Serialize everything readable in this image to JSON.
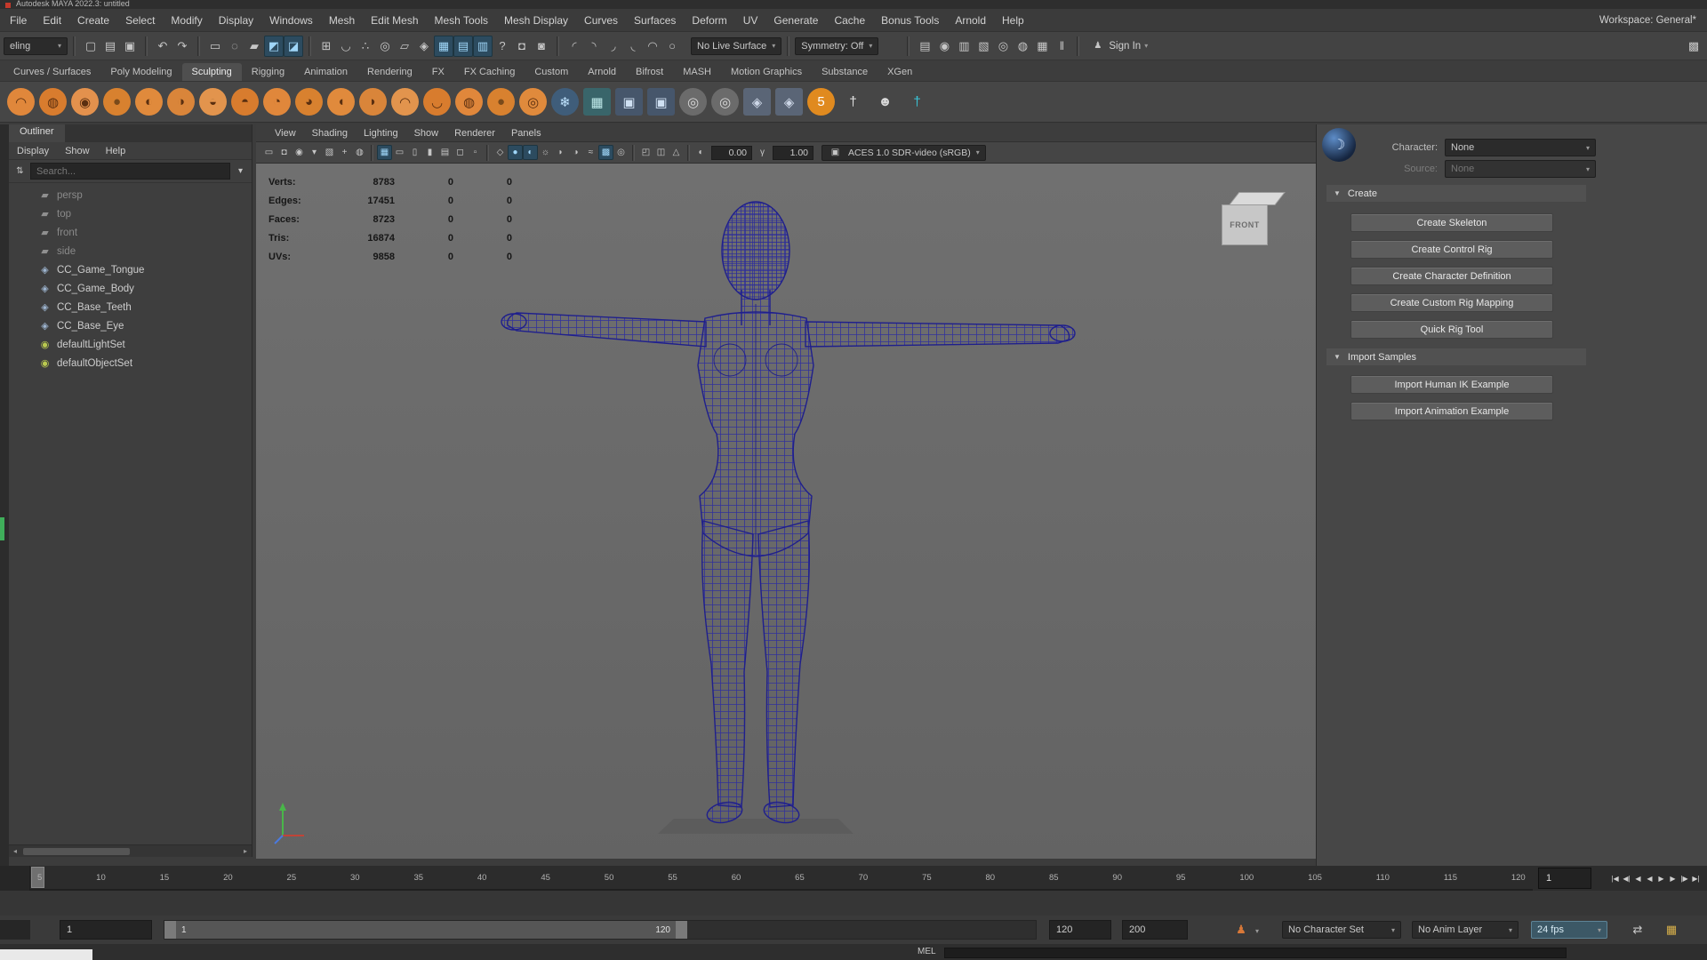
{
  "title_bar": {
    "title": "Autodesk MAYA 2022.3: untitled"
  },
  "menu_bar": {
    "items": [
      "File",
      "Edit",
      "Create",
      "Select",
      "Modify",
      "Display",
      "Windows",
      "Mesh",
      "Edit Mesh",
      "Mesh Tools",
      "Mesh Display",
      "Curves",
      "Surfaces",
      "Deform",
      "UV",
      "Generate",
      "Cache",
      "Bonus Tools",
      "Arnold",
      "Help"
    ],
    "workspace": "Workspace: General*"
  },
  "status_line": {
    "workspace_value": "eling",
    "file_icons": [
      {
        "n": "new-scene-icon",
        "g": "▢"
      },
      {
        "n": "open-scene-icon",
        "g": "▤"
      },
      {
        "n": "save-scene-icon",
        "g": "▣"
      }
    ],
    "undo_icons": [
      {
        "n": "undo-icon",
        "g": "↶"
      },
      {
        "n": "redo-icon",
        "g": "↷"
      }
    ],
    "selection_icons": [
      {
        "n": "select-tool-icon",
        "g": "▭"
      },
      {
        "n": "lasso-select-icon",
        "g": "◌"
      },
      {
        "n": "paint-select-icon",
        "g": "▰"
      },
      {
        "n": "select-object-mode-icon",
        "g": "◩",
        "s": "on"
      },
      {
        "n": "select-component-mode-icon",
        "g": "◪",
        "s": "on"
      }
    ],
    "snap_icons": [
      {
        "n": "snap-to-grid-icon",
        "g": "⊞"
      },
      {
        "n": "snap-to-curve-icon",
        "g": "◡"
      },
      {
        "n": "snap-to-point-icon",
        "g": "∴"
      },
      {
        "n": "snap-to-projected-center-icon",
        "g": "◎"
      },
      {
        "n": "snap-to-view-plane-icon",
        "g": "▱"
      },
      {
        "n": "make-live-icon",
        "g": "◈"
      },
      {
        "n": "modeling-toolkit-icon",
        "g": "▦",
        "s": "on"
      },
      {
        "n": "soft-select-icon",
        "g": "▤",
        "s": "on"
      },
      {
        "n": "symmetry-grid-icon",
        "g": "▥",
        "s": "on"
      },
      {
        "n": "help-icon",
        "g": "?"
      },
      {
        "n": "lock-selection-icon",
        "g": "◘"
      },
      {
        "n": "highlight-selection-icon",
        "g": "◙"
      }
    ],
    "curve_icons": [
      {
        "n": "curve-tool-icon",
        "g": "◜"
      },
      {
        "n": "cv-curve-icon",
        "g": "◝"
      },
      {
        "n": "ep-curve-icon",
        "g": "◞"
      },
      {
        "n": "pencil-curve-icon",
        "g": "◟"
      },
      {
        "n": "arc-tool-icon",
        "g": "◠"
      },
      {
        "n": "circle-tool-icon",
        "g": "○"
      }
    ],
    "live_surface_label": "No Live Surface",
    "symmetry_label": "Symmetry: Off",
    "render_icons": [
      {
        "n": "render-settings-icon",
        "g": "▤"
      },
      {
        "n": "hypershade-icon",
        "g": "◉"
      },
      {
        "n": "render-view-icon",
        "g": "▥"
      },
      {
        "n": "texture-view-icon",
        "g": "▧"
      },
      {
        "n": "render-current-frame-icon",
        "g": "◎"
      },
      {
        "n": "ipr-render-icon",
        "g": "◍"
      },
      {
        "n": "render-sequence-icon",
        "g": "▦"
      },
      {
        "n": "pause-viewport-icon",
        "g": "‖"
      }
    ],
    "sign_in_label": "Sign In",
    "right_icons": [
      {
        "n": "raise-panels-icon",
        "g": "▩"
      }
    ]
  },
  "shelf": {
    "tabs": [
      {
        "l": "Curves / Surfaces"
      },
      {
        "l": "Poly Modeling"
      },
      {
        "l": "Sculpting",
        "s": "on"
      },
      {
        "l": "Rigging"
      },
      {
        "l": "Animation"
      },
      {
        "l": "Rendering"
      },
      {
        "l": "FX"
      },
      {
        "l": "FX Caching"
      },
      {
        "l": "Custom"
      },
      {
        "l": "Arnold"
      },
      {
        "l": "Bifrost"
      },
      {
        "l": "MASH"
      },
      {
        "l": "Motion Graphics"
      },
      {
        "l": "Substance"
      },
      {
        "l": "XGen"
      }
    ],
    "icons": [
      {
        "n": "lift-brush-icon",
        "g": "◠",
        "bg": "#e0873b",
        "fg": "#5a2f10"
      },
      {
        "n": "sculpt-brush-icon",
        "g": "◍",
        "bg": "#d87c2e",
        "fg": "#5a2f10"
      },
      {
        "n": "smooth-brush-icon",
        "g": "◉",
        "bg": "#e3914d",
        "fg": "#5a2f10"
      },
      {
        "n": "relax-brush-icon",
        "g": "●",
        "bg": "#d8812f",
        "fg": "#7a4a1a"
      },
      {
        "n": "grab-brush-icon",
        "g": "◐",
        "bg": "#e08a3c",
        "fg": "#5a2f10"
      },
      {
        "n": "pinch-brush-icon",
        "g": "◑",
        "bg": "#d9853a",
        "fg": "#5a2f10"
      },
      {
        "n": "flatten-brush-icon",
        "g": "◒",
        "bg": "#e2944d",
        "fg": "#5a2f10"
      },
      {
        "n": "foamy-brush-icon",
        "g": "◓",
        "bg": "#d87c2e",
        "fg": "#5a2f10"
      },
      {
        "n": "spray-brush-icon",
        "g": "◔",
        "bg": "#e0873b",
        "fg": "#5a2f10"
      },
      {
        "n": "repeat-brush-icon",
        "g": "◕",
        "bg": "#d8812f",
        "fg": "#5a2f10"
      },
      {
        "n": "imprint-brush-icon",
        "g": "◖",
        "bg": "#e08a3c",
        "fg": "#5a2f10"
      },
      {
        "n": "wax-brush-icon",
        "g": "◗",
        "bg": "#d9853a",
        "fg": "#5a2f10"
      },
      {
        "n": "scrape-brush-icon",
        "g": "◠",
        "bg": "#e2944d",
        "fg": "#5a2f10"
      },
      {
        "n": "fill-brush-icon",
        "g": "◡",
        "bg": "#d87c2e",
        "fg": "#5a2f10"
      },
      {
        "n": "knife-brush-icon",
        "g": "◍",
        "bg": "#e0873b",
        "fg": "#5a2f10"
      },
      {
        "n": "smear-brush-icon",
        "g": "●",
        "bg": "#d8812f",
        "fg": "#7a4a1a"
      },
      {
        "n": "bulge-brush-icon",
        "g": "◎",
        "bg": "#e08a3c",
        "fg": "#5a2f10"
      },
      {
        "n": "freeze-brush-icon",
        "g": "❄",
        "bg": "#3f5d7a",
        "fg": "#bfe4ff"
      },
      {
        "n": "unfreeze-icon",
        "g": "▦",
        "bg": "#39656a",
        "fg": "#bfeaea",
        "r": "3px"
      },
      {
        "n": "frame-selection-icon",
        "g": "▣",
        "bg": "#46566b",
        "fg": "#cfe0f2",
        "r": "3px"
      },
      {
        "n": "frame-all-icon",
        "g": "▣",
        "bg": "#46566b",
        "fg": "#cfe0f2",
        "r": "3px"
      },
      {
        "n": "sculpt-sphere-icon",
        "g": "◎",
        "bg": "#6b6b6b",
        "fg": "#dcdcdc"
      },
      {
        "n": "sculpt-sphere-2-icon",
        "g": "◎",
        "bg": "#6b6b6b",
        "fg": "#dcdcdc"
      },
      {
        "n": "mirror-brush-icon",
        "g": "◈",
        "bg": "#5a6576",
        "fg": "#ccd6e6",
        "r": "3px"
      },
      {
        "n": "mirror-brush-2-icon",
        "g": "◈",
        "bg": "#5a6576",
        "fg": "#ccd6e6",
        "r": "3px"
      },
      {
        "n": "five-special-brush-icon",
        "g": "5",
        "bg": "#e08a1f",
        "fg": "#ffffff"
      },
      {
        "n": "t-pose-figure-icon",
        "g": "†",
        "fg": "#e6e6e6"
      },
      {
        "n": "mask-face-icon",
        "g": "☻",
        "fg": "#d8d8d8"
      },
      {
        "n": "cyan-t-pose-figure-icon",
        "g": "†",
        "fg": "#39c8dc"
      }
    ]
  },
  "outliner": {
    "tab": "Outliner",
    "menus": [
      "Display",
      "Show",
      "Help"
    ],
    "search_placeholder": "Search...",
    "items": [
      {
        "label": "persp",
        "g": "▰",
        "c": "#8f8f8f",
        "dim": "dim"
      },
      {
        "label": "top",
        "g": "▰",
        "c": "#8f8f8f",
        "dim": "dim"
      },
      {
        "label": "front",
        "g": "▰",
        "c": "#8f8f8f",
        "dim": "dim"
      },
      {
        "label": "side",
        "g": "▰",
        "c": "#8f8f8f",
        "dim": "dim"
      },
      {
        "label": "CC_Game_Tongue",
        "g": "◈",
        "c": "#9db4cf"
      },
      {
        "label": "CC_Game_Body",
        "g": "◈",
        "c": "#9db4cf"
      },
      {
        "label": "CC_Base_Teeth",
        "g": "◈",
        "c": "#9db4cf"
      },
      {
        "label": "CC_Base_Eye",
        "g": "◈",
        "c": "#9db4cf"
      },
      {
        "label": "defaultLightSet",
        "g": "◉",
        "c": "#b9c94f"
      },
      {
        "label": "defaultObjectSet",
        "g": "◉",
        "c": "#b9c94f"
      }
    ]
  },
  "viewport": {
    "menus": [
      "View",
      "Shading",
      "Lighting",
      "Show",
      "Renderer",
      "Panels"
    ],
    "cam_icons": [
      {
        "n": "select-camera-icon",
        "g": "▭"
      },
      {
        "n": "lock-camera-icon",
        "g": "◘"
      },
      {
        "n": "camera-attributes-icon",
        "g": "◉"
      },
      {
        "n": "bookmarks-icon",
        "g": "▾"
      },
      {
        "n": "image-plane-icon",
        "g": "▧"
      },
      {
        "n": "pan-zoom-icon",
        "g": "+"
      },
      {
        "n": "oversampling-icon",
        "g": "◍"
      }
    ],
    "gate_icons": [
      {
        "n": "grid-icon",
        "g": "▦",
        "s": "on"
      },
      {
        "n": "film-gate-icon",
        "g": "▭"
      },
      {
        "n": "resolution-gate-icon",
        "g": "▯"
      },
      {
        "n": "gate-mask-icon",
        "g": "▮"
      },
      {
        "n": "field-chart-icon",
        "g": "▤"
      },
      {
        "n": "safe-action-icon",
        "g": "◻"
      },
      {
        "n": "safe-title-icon",
        "g": "▫"
      }
    ],
    "shade_icons": [
      {
        "n": "wireframe-icon",
        "g": "◇"
      },
      {
        "n": "shaded-icon",
        "g": "●",
        "s": "on"
      },
      {
        "n": "textured-icon",
        "g": "◐",
        "s": "on"
      },
      {
        "n": "use-all-lights-icon",
        "g": "☼"
      },
      {
        "n": "shadows-icon",
        "g": "◗"
      },
      {
        "n": "ambient-occlusion-icon",
        "g": "◑"
      },
      {
        "n": "motion-blur-icon",
        "g": "≈"
      },
      {
        "n": "multisample-aa-icon",
        "g": "▩",
        "s": "on"
      },
      {
        "n": "depth-of-field-icon",
        "g": "◎"
      }
    ],
    "xray_icons": [
      {
        "n": "isolate-select-icon",
        "g": "◰"
      },
      {
        "n": "xray-icon",
        "g": "◫"
      },
      {
        "n": "xray-joints-icon",
        "g": "△"
      }
    ],
    "exposure": "0.00",
    "gamma": "1.00",
    "colorspace": "ACES 1.0 SDR-video (sRGB)",
    "viewcube_label": "FRONT",
    "hud": [
      {
        "l": "Verts:",
        "v": "8783",
        "a": "0",
        "b": "0"
      },
      {
        "l": "Edges:",
        "v": "17451",
        "a": "0",
        "b": "0"
      },
      {
        "l": "Faces:",
        "v": "8723",
        "a": "0",
        "b": "0"
      },
      {
        "l": "Tris:",
        "v": "16874",
        "a": "0",
        "b": "0"
      },
      {
        "l": "UVs:",
        "v": "9858",
        "a": "0",
        "b": "0"
      }
    ]
  },
  "humanik": {
    "character_label": "Character:",
    "character_value": "None",
    "source_label": "Source:",
    "source_value": "None",
    "create_title": "Create",
    "create_buttons": [
      "Create Skeleton",
      "Create Control Rig",
      "Create Character Definition",
      "Create Custom Rig Mapping",
      "Quick Rig Tool"
    ],
    "import_title": "Import Samples",
    "import_buttons": [
      "Import Human IK Example",
      "Import Animation Example"
    ]
  },
  "time_slider": {
    "ticks": [
      "5",
      "10",
      "15",
      "20",
      "25",
      "30",
      "35",
      "40",
      "45",
      "50",
      "55",
      "60",
      "65",
      "70",
      "75",
      "80",
      "85",
      "90",
      "95",
      "100",
      "105",
      "110",
      "115",
      "120"
    ],
    "current": "1",
    "transport": [
      {
        "n": "go-to-start-button",
        "g": "|◀"
      },
      {
        "n": "step-back-key-button",
        "g": "◀|"
      },
      {
        "n": "step-back-frame-button",
        "g": "◀"
      },
      {
        "n": "play-backwards-button",
        "g": "◀"
      },
      {
        "n": "play-forwards-button",
        "g": "▶"
      },
      {
        "n": "step-forward-frame-button",
        "g": "▶"
      },
      {
        "n": "step-forward-key-button",
        "g": "|▶"
      },
      {
        "n": "go-to-end-button",
        "g": "▶|"
      }
    ]
  },
  "range_slider": {
    "start": "1",
    "range_start": "1",
    "range_end": "120",
    "end": "120",
    "scene_end": "200",
    "character_set": "No Character Set",
    "anim_layer": "No Anim Layer",
    "fps": "24 fps"
  },
  "command_line": {
    "label": "MEL"
  }
}
